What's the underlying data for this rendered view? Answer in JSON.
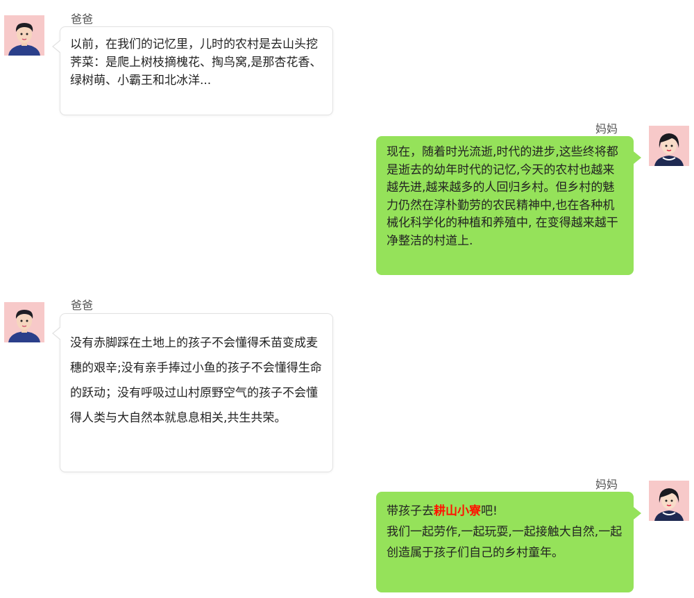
{
  "messages": [
    {
      "sender": "爸爸",
      "side": "left",
      "avatar": "dad-avatar-icon",
      "text": "以前，在我们的记忆里，儿时的农村是去山头挖荠菜：是爬上树枝摘槐花、掏鸟窝,是那杏花香、绿树萌、小霸王和北冰洋..."
    },
    {
      "sender": "妈妈",
      "side": "right",
      "avatar": "mom-avatar-icon",
      "text": "现在，随着时光流逝,时代的进步,这些终将都是逝去的幼年时代的记忆,今天的农村也越来越先进,越来越多的人回归乡村。但乡村的魅力仍然在淳朴勤劳的农民精神中,也在各种机械化科学化的种植和养殖中, 在变得越来越干净整洁的村道上."
    },
    {
      "sender": "爸爸",
      "side": "left",
      "avatar": "dad-avatar-icon",
      "text": "没有赤脚踩在土地上的孩子不会懂得禾苗变成麦穗的艰辛;没有亲手捧过小鱼的孩子不会懂得生命的跃动；没有呼吸过山村原野空气的孩子不会懂得人类与大自然本就息息相关,共生共荣。"
    },
    {
      "sender": "妈妈",
      "side": "right",
      "avatar": "mom-avatar-icon",
      "text_before": "带孩子去",
      "highlight": "耕山小寮",
      "text_after": "吧!",
      "text_line2": "我们一起劳作,一起玩耍,一起接触大自然,一起创造属于孩子们自己的乡村童年。"
    }
  ],
  "colors": {
    "right_bubble": "#95e25a",
    "left_bubble": "#ffffff",
    "highlight": "#ff1200"
  }
}
